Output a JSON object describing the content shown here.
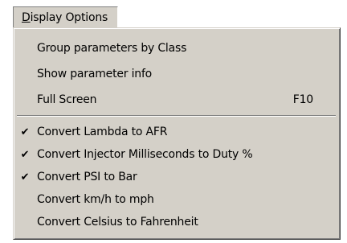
{
  "menu": {
    "title_mnemonic": "D",
    "title_rest": "isplay Options"
  },
  "group1": [
    {
      "label": "Group parameters by Class",
      "shortcut": "",
      "checked": false
    },
    {
      "label": "Show parameter info",
      "shortcut": "",
      "checked": false
    },
    {
      "label": "Full Screen",
      "shortcut": "F10",
      "checked": false
    }
  ],
  "group2": [
    {
      "label": "Convert Lambda to AFR",
      "shortcut": "",
      "checked": true,
      "check": "✔"
    },
    {
      "label": "Convert Injector Milliseconds to Duty %",
      "shortcut": "",
      "checked": true,
      "check": "✔"
    },
    {
      "label": "Convert PSI to Bar",
      "shortcut": "",
      "checked": true,
      "check": "✔"
    },
    {
      "label": "Convert km/h to mph",
      "shortcut": "",
      "checked": false
    },
    {
      "label": "Convert Celsius to Fahrenheit",
      "shortcut": "",
      "checked": false
    }
  ]
}
